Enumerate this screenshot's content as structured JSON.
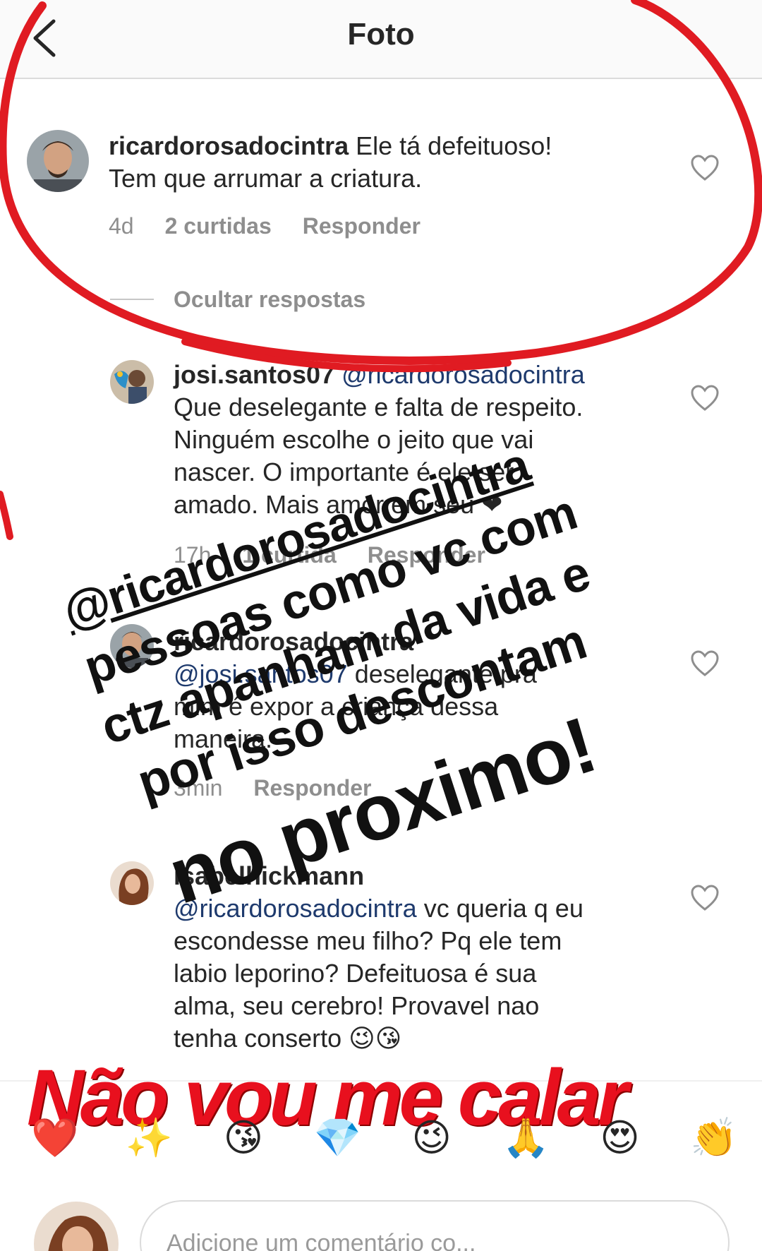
{
  "header": {
    "title": "Foto"
  },
  "comments": {
    "main": {
      "username": "ricardorosadocintra",
      "line1": " Ele tá defeituoso!",
      "line2": "Tem que arrumar a criatura.",
      "time": "4d",
      "likes": "2 curtidas",
      "reply": "Responder"
    },
    "hide_replies": "Ocultar respostas",
    "reply1": {
      "username": "josi.santos07",
      "mention": " @ricardorosadocintra",
      "lines": [
        "Que deselegante e falta de respeito.",
        "Ninguém escolhe o jeito que vai",
        "nascer. O importante é ele ser",
        "amado. Mais amor em seu ❤"
      ],
      "time": "17h",
      "likes": "1 curtida",
      "reply": "Responder"
    },
    "reply2": {
      "username": "ricardorosadocintra",
      "mention": "@josi.santos07",
      "line1_rest": " deselegante pra",
      "lines": [
        "mim é expor a criança dessa",
        "maneira."
      ],
      "time": "3min",
      "reply": "Responder"
    },
    "reply3": {
      "username": "isabelhickmann",
      "mention": "@ricardorosadocintra",
      "line1_rest": " vc queria q eu",
      "lines": [
        "escondesse meu filho? Pq ele tem",
        "labio leporino? Defeituosa é sua",
        "alma, seu cerebro! Provavel nao",
        "tenha conserto 😉😘"
      ]
    }
  },
  "overlay": {
    "line1": "@ricardorosadocintra",
    "line2": "pessoas como vc com",
    "line3": "ctz apanham da vida e",
    "line4": "por isso descontam",
    "line5": "no proximo!",
    "headline": "Não vou me calar"
  },
  "emoji_bar": [
    "❤️",
    "✨",
    "😘",
    "💎",
    "😉",
    "🙏",
    "😍",
    "👏"
  ],
  "composer": {
    "placeholder": "Adicione um comentário co..."
  },
  "colors": {
    "annotation_red": "#e01b22",
    "headline_red": "#e8101e",
    "mention_blue": "#1e3a6d",
    "meta_gray": "#8e8e8e"
  }
}
